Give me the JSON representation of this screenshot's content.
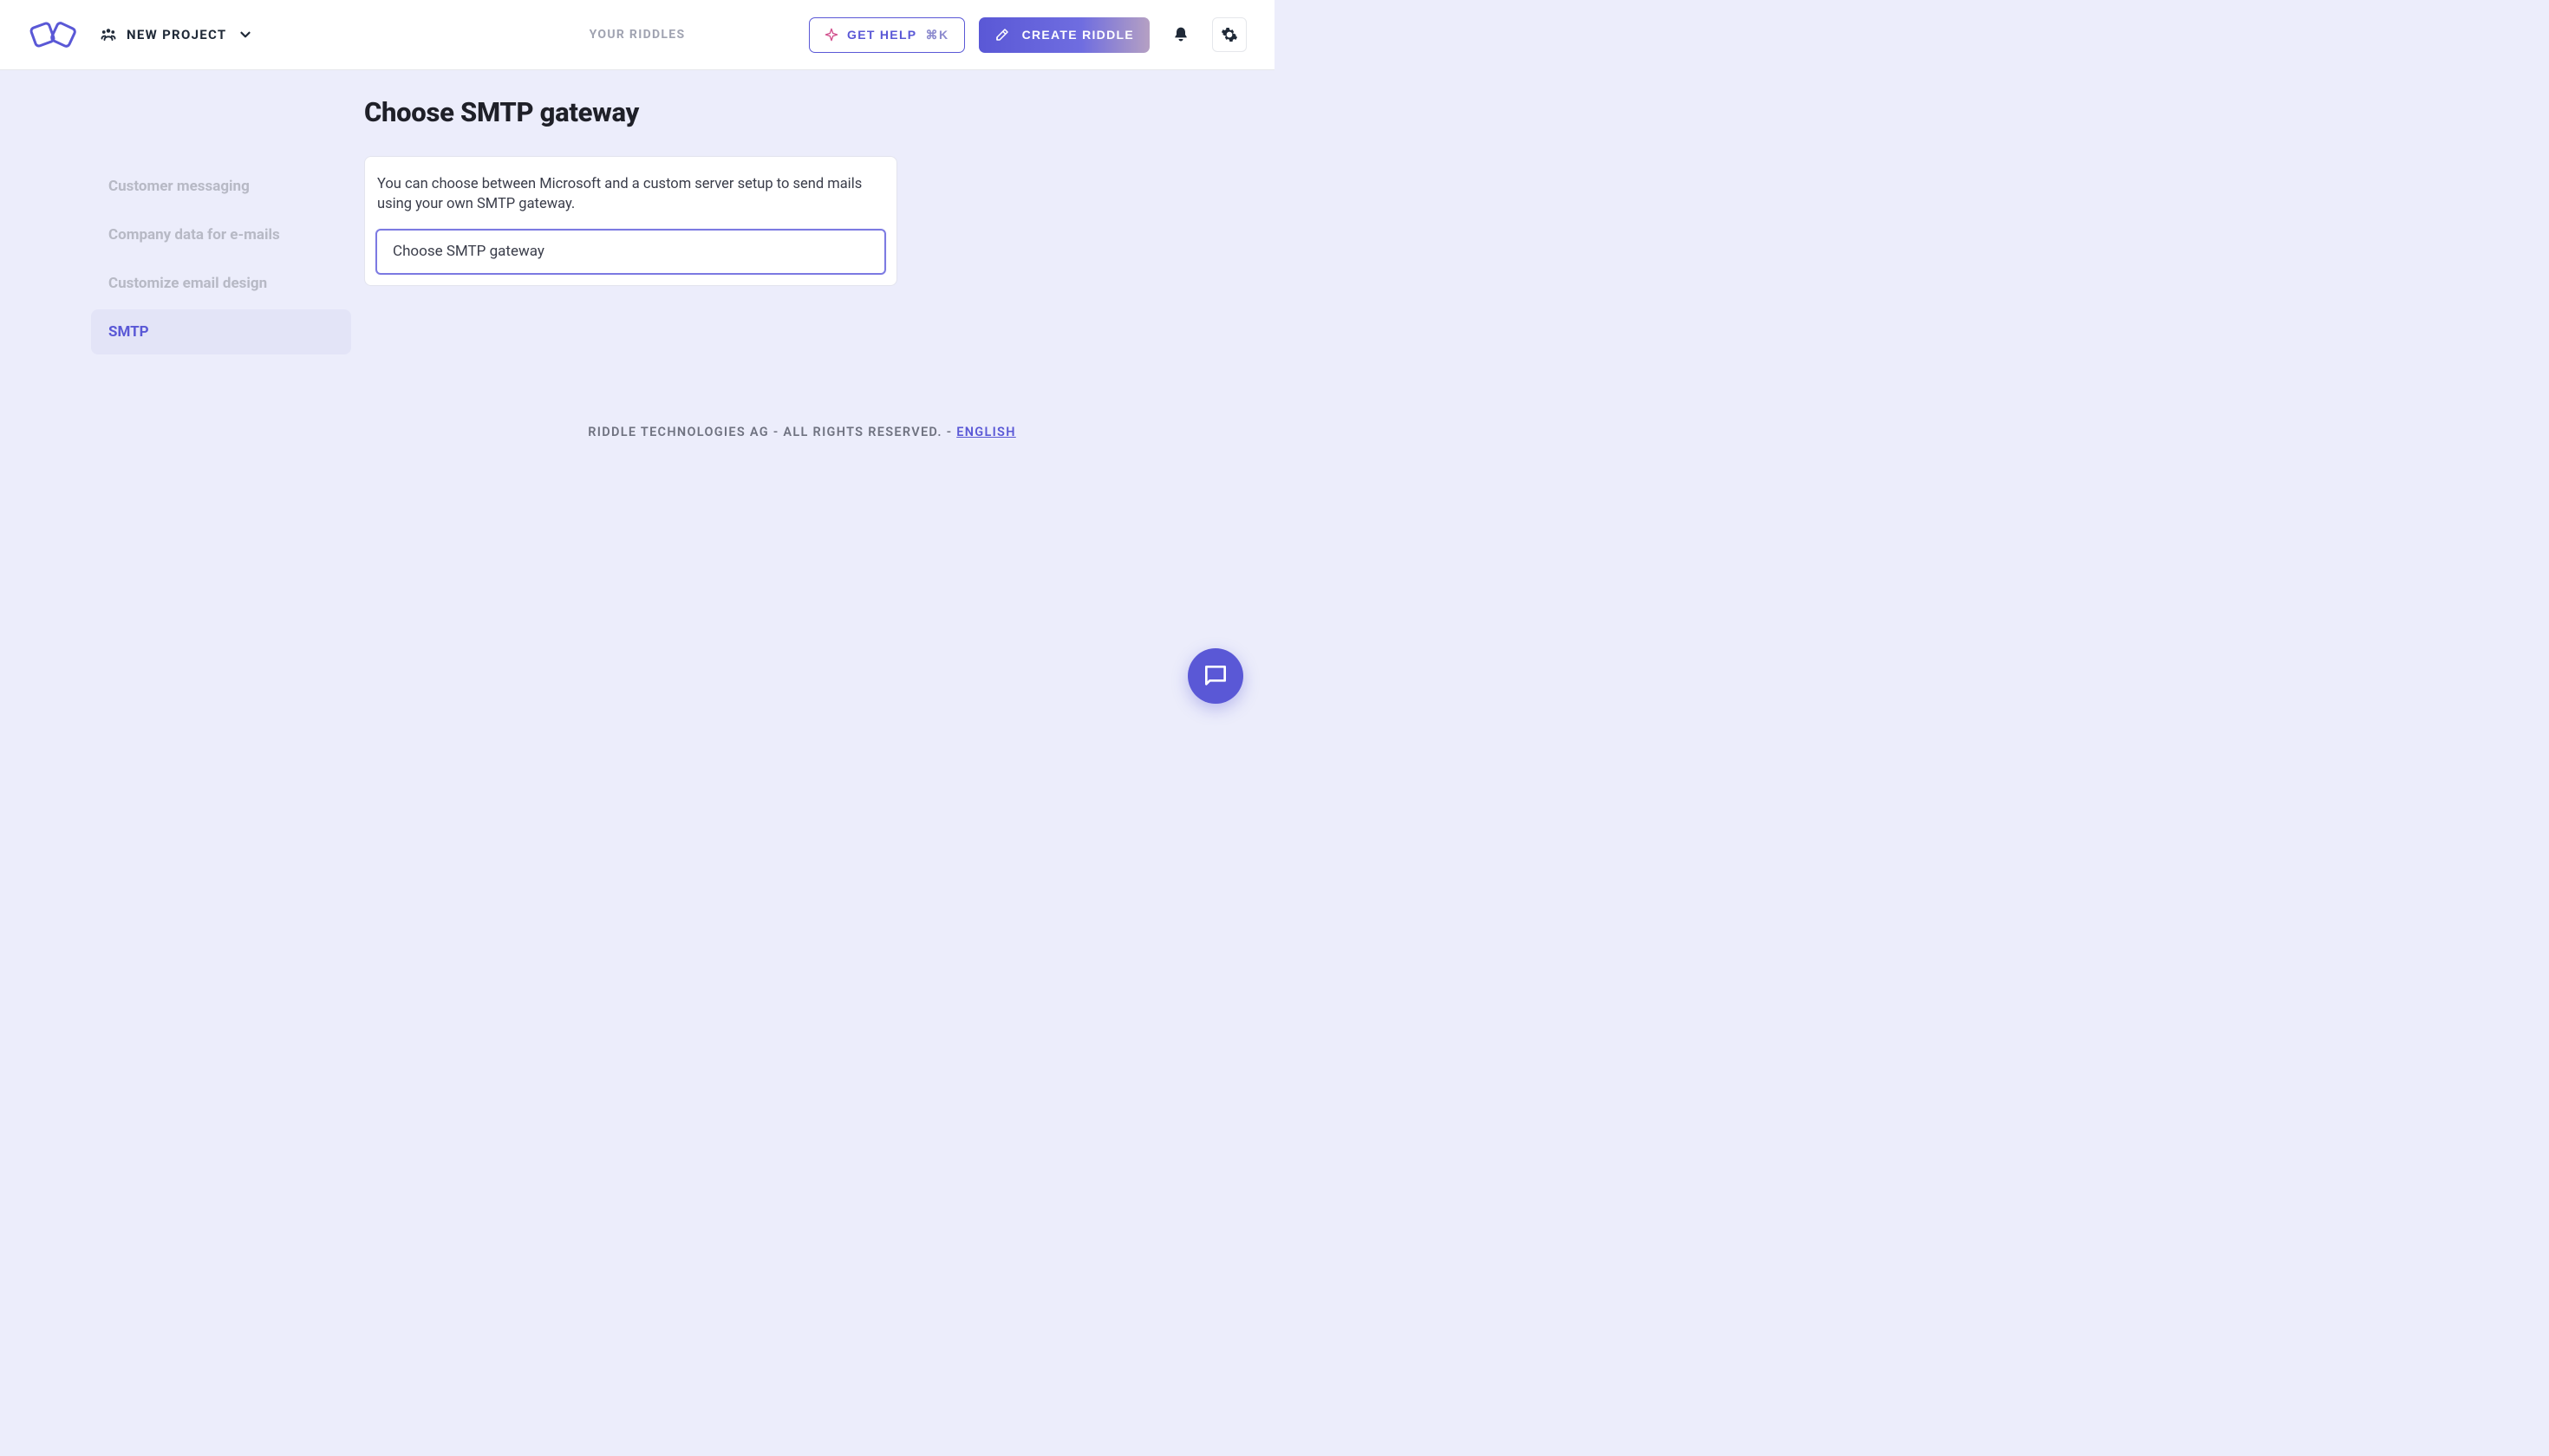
{
  "header": {
    "project_label": "NEW PROJECT",
    "center_link": "YOUR RIDDLES",
    "get_help_label": "GET HELP",
    "get_help_shortcut": "⌘K",
    "create_label": "CREATE RIDDLE"
  },
  "sidebar": {
    "items": [
      {
        "label": "Customer messaging",
        "active": false
      },
      {
        "label": "Company data for e-mails",
        "active": false
      },
      {
        "label": "Customize email design",
        "active": false
      },
      {
        "label": "SMTP",
        "active": true
      }
    ]
  },
  "page": {
    "title": "Choose SMTP gateway",
    "description": "You can choose between Microsoft and a custom server setup to send mails using your own SMTP gateway.",
    "select_placeholder": "Choose SMTP gateway"
  },
  "footer": {
    "text": "RIDDLE TECHNOLOGIES AG - ALL RIGHTS RESERVED. - ",
    "language": "ENGLISH"
  }
}
